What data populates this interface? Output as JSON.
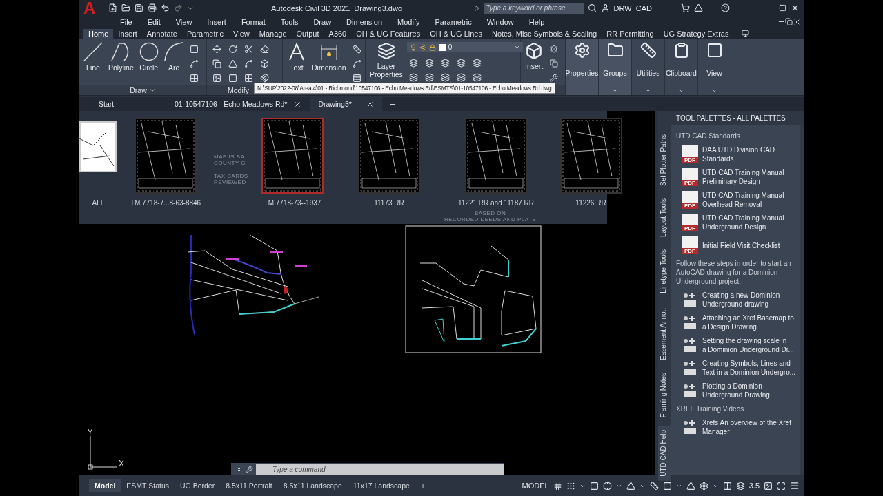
{
  "app": {
    "logo": "A",
    "title": "Autodesk Civil 3D 2021",
    "document": "Drawing3.dwg",
    "search": {
      "placeholder": "Type a keyword or phrase"
    },
    "user": "DRW_CAD"
  },
  "menu": [
    "File",
    "Edit",
    "View",
    "Insert",
    "Format",
    "Tools",
    "Draw",
    "Dimension",
    "Modify",
    "Parametric",
    "Window",
    "Help"
  ],
  "ribbon_tabs": [
    {
      "label": "Home",
      "selected": true
    },
    {
      "label": "Insert",
      "selected": false
    },
    {
      "label": "Annotate",
      "selected": false
    },
    {
      "label": "Parametric",
      "selected": false
    },
    {
      "label": "View",
      "selected": false
    },
    {
      "label": "Manage",
      "selected": false
    },
    {
      "label": "Output",
      "selected": false
    },
    {
      "label": "A360",
      "selected": false
    },
    {
      "label": "OH & UG Features",
      "selected": false
    },
    {
      "label": "OH & UG Lines",
      "selected": false
    },
    {
      "label": "Notes, Misc Symbols & Scaling",
      "selected": false
    },
    {
      "label": "RR Permitting",
      "selected": false
    },
    {
      "label": "UG Strategy Extras",
      "selected": false
    }
  ],
  "ribbon": {
    "draw": {
      "title": "Draw",
      "tools": [
        "Line",
        "Polyline",
        "Circle",
        "Arc"
      ]
    },
    "modify": {
      "title": "Modify"
    },
    "annotation": {
      "tools": [
        "Text",
        "Dimension"
      ]
    },
    "layers": {
      "tool": "Layer Properties",
      "current_layer": "0"
    },
    "block": {
      "tool": "Insert"
    },
    "buttons": [
      "Properties",
      "Groups",
      "Utilities",
      "Clipboard",
      "View"
    ]
  },
  "tooltip": "N:\\SUP\\2022-08\\Area 4\\01 - Richmond\\10547106 - Echo Meadows Rd\\ESMTS\\01-10547106 - Echo Meadows Rd.dwg",
  "file_tabs": [
    {
      "label": "Start",
      "selected": false,
      "closable": false
    },
    {
      "label": "01-10547106 - Echo Meadows Rd*",
      "selected": false,
      "closable": true
    },
    {
      "label": "Drawing3*",
      "selected": true,
      "closable": true
    }
  ],
  "layout_thumbnails": [
    {
      "label": "ALL",
      "selected": false
    },
    {
      "label": "TM 7718-7...8-63-8846",
      "selected": false
    },
    {
      "label": "TM 7718-73--1937",
      "selected": true
    },
    {
      "label": "11173 RR",
      "selected": false
    },
    {
      "label": "11221 RR and 11187 RR",
      "selected": false
    },
    {
      "label": "11226 RR",
      "selected": false
    }
  ],
  "drawing_notes": [
    {
      "lines": [
        "MAP IS BA",
        "COUNTY G"
      ]
    },
    {
      "lines": [
        "TAX CARDS",
        "REVIEWED"
      ]
    },
    {
      "lines": [
        "BASED ON",
        "RECORDED DEEDS AND PLATS"
      ]
    }
  ],
  "ucs": {
    "y": "Y",
    "x": "X"
  },
  "command_line": {
    "placeholder": "Type a command"
  },
  "tool_palette": {
    "title": "TOOL PALETTES - ALL PALETTES",
    "tabs": [
      {
        "label": "Set Plotter Paths",
        "selected": false
      },
      {
        "label": "Layout Tools",
        "selected": false
      },
      {
        "label": "Linetype Tools",
        "selected": false
      },
      {
        "label": "Easement Anno...",
        "selected": false
      },
      {
        "label": "Framing Notes",
        "selected": false
      },
      {
        "label": "UTD CAD Help",
        "selected": true
      }
    ],
    "items": [
      {
        "kind": "heading",
        "lines": [
          "UTD CAD Standards"
        ]
      },
      {
        "kind": "pdf",
        "icon_label": "PDF",
        "lines": [
          "DAA UTD Division CAD",
          "Standards"
        ]
      },
      {
        "kind": "pdf",
        "icon_label": "PDF",
        "lines": [
          "UTD CAD Training Manual",
          "Preliminary Design"
        ]
      },
      {
        "kind": "pdf",
        "icon_label": "PDF",
        "lines": [
          "UTD CAD Training Manual",
          "Overhead Removal"
        ]
      },
      {
        "kind": "pdf",
        "icon_label": "PDF",
        "lines": [
          "UTD CAD Training Manual",
          "Underground Design"
        ]
      },
      {
        "kind": "pdf",
        "icon_label": "PDF",
        "lines": [
          "Initial Field Visit Checklist"
        ]
      },
      {
        "kind": "note",
        "lines": [
          "Follow these steps in order to start an",
          "AutoCAD drawing for a Dominion",
          "Underground project."
        ]
      },
      {
        "kind": "tool",
        "lines": [
          "Creating a new Dominion",
          "Underground drawing"
        ]
      },
      {
        "kind": "tool",
        "lines": [
          "Attaching an Xref Basemap to",
          "a Design Drawing"
        ]
      },
      {
        "kind": "tool",
        "lines": [
          "Setting the drawing scale in",
          "a  Dominion Underground Dr..."
        ]
      },
      {
        "kind": "tool",
        "lines": [
          "Creating Symbols, Lines and",
          "Text in a Dominion Undergro..."
        ]
      },
      {
        "kind": "tool",
        "lines": [
          "Plotting a Dominion",
          "Underground Drawing"
        ]
      },
      {
        "kind": "heading",
        "lines": [
          "XREF Training Videos"
        ]
      },
      {
        "kind": "tool",
        "lines": [
          "Xrefs An overview of the Xref",
          "Manager"
        ]
      }
    ]
  },
  "layout_tabs": [
    {
      "label": "Model",
      "selected": true
    },
    {
      "label": "ESMT Status",
      "selected": false
    },
    {
      "label": "UG Border",
      "selected": false
    },
    {
      "label": "8.5x11 Portrait",
      "selected": false
    },
    {
      "label": "8.5x11 Landscape",
      "selected": false
    },
    {
      "label": "11x17 Landscape",
      "selected": false
    }
  ],
  "add_tab": "+",
  "status": {
    "mode": "MODEL",
    "scale": "3.5"
  }
}
